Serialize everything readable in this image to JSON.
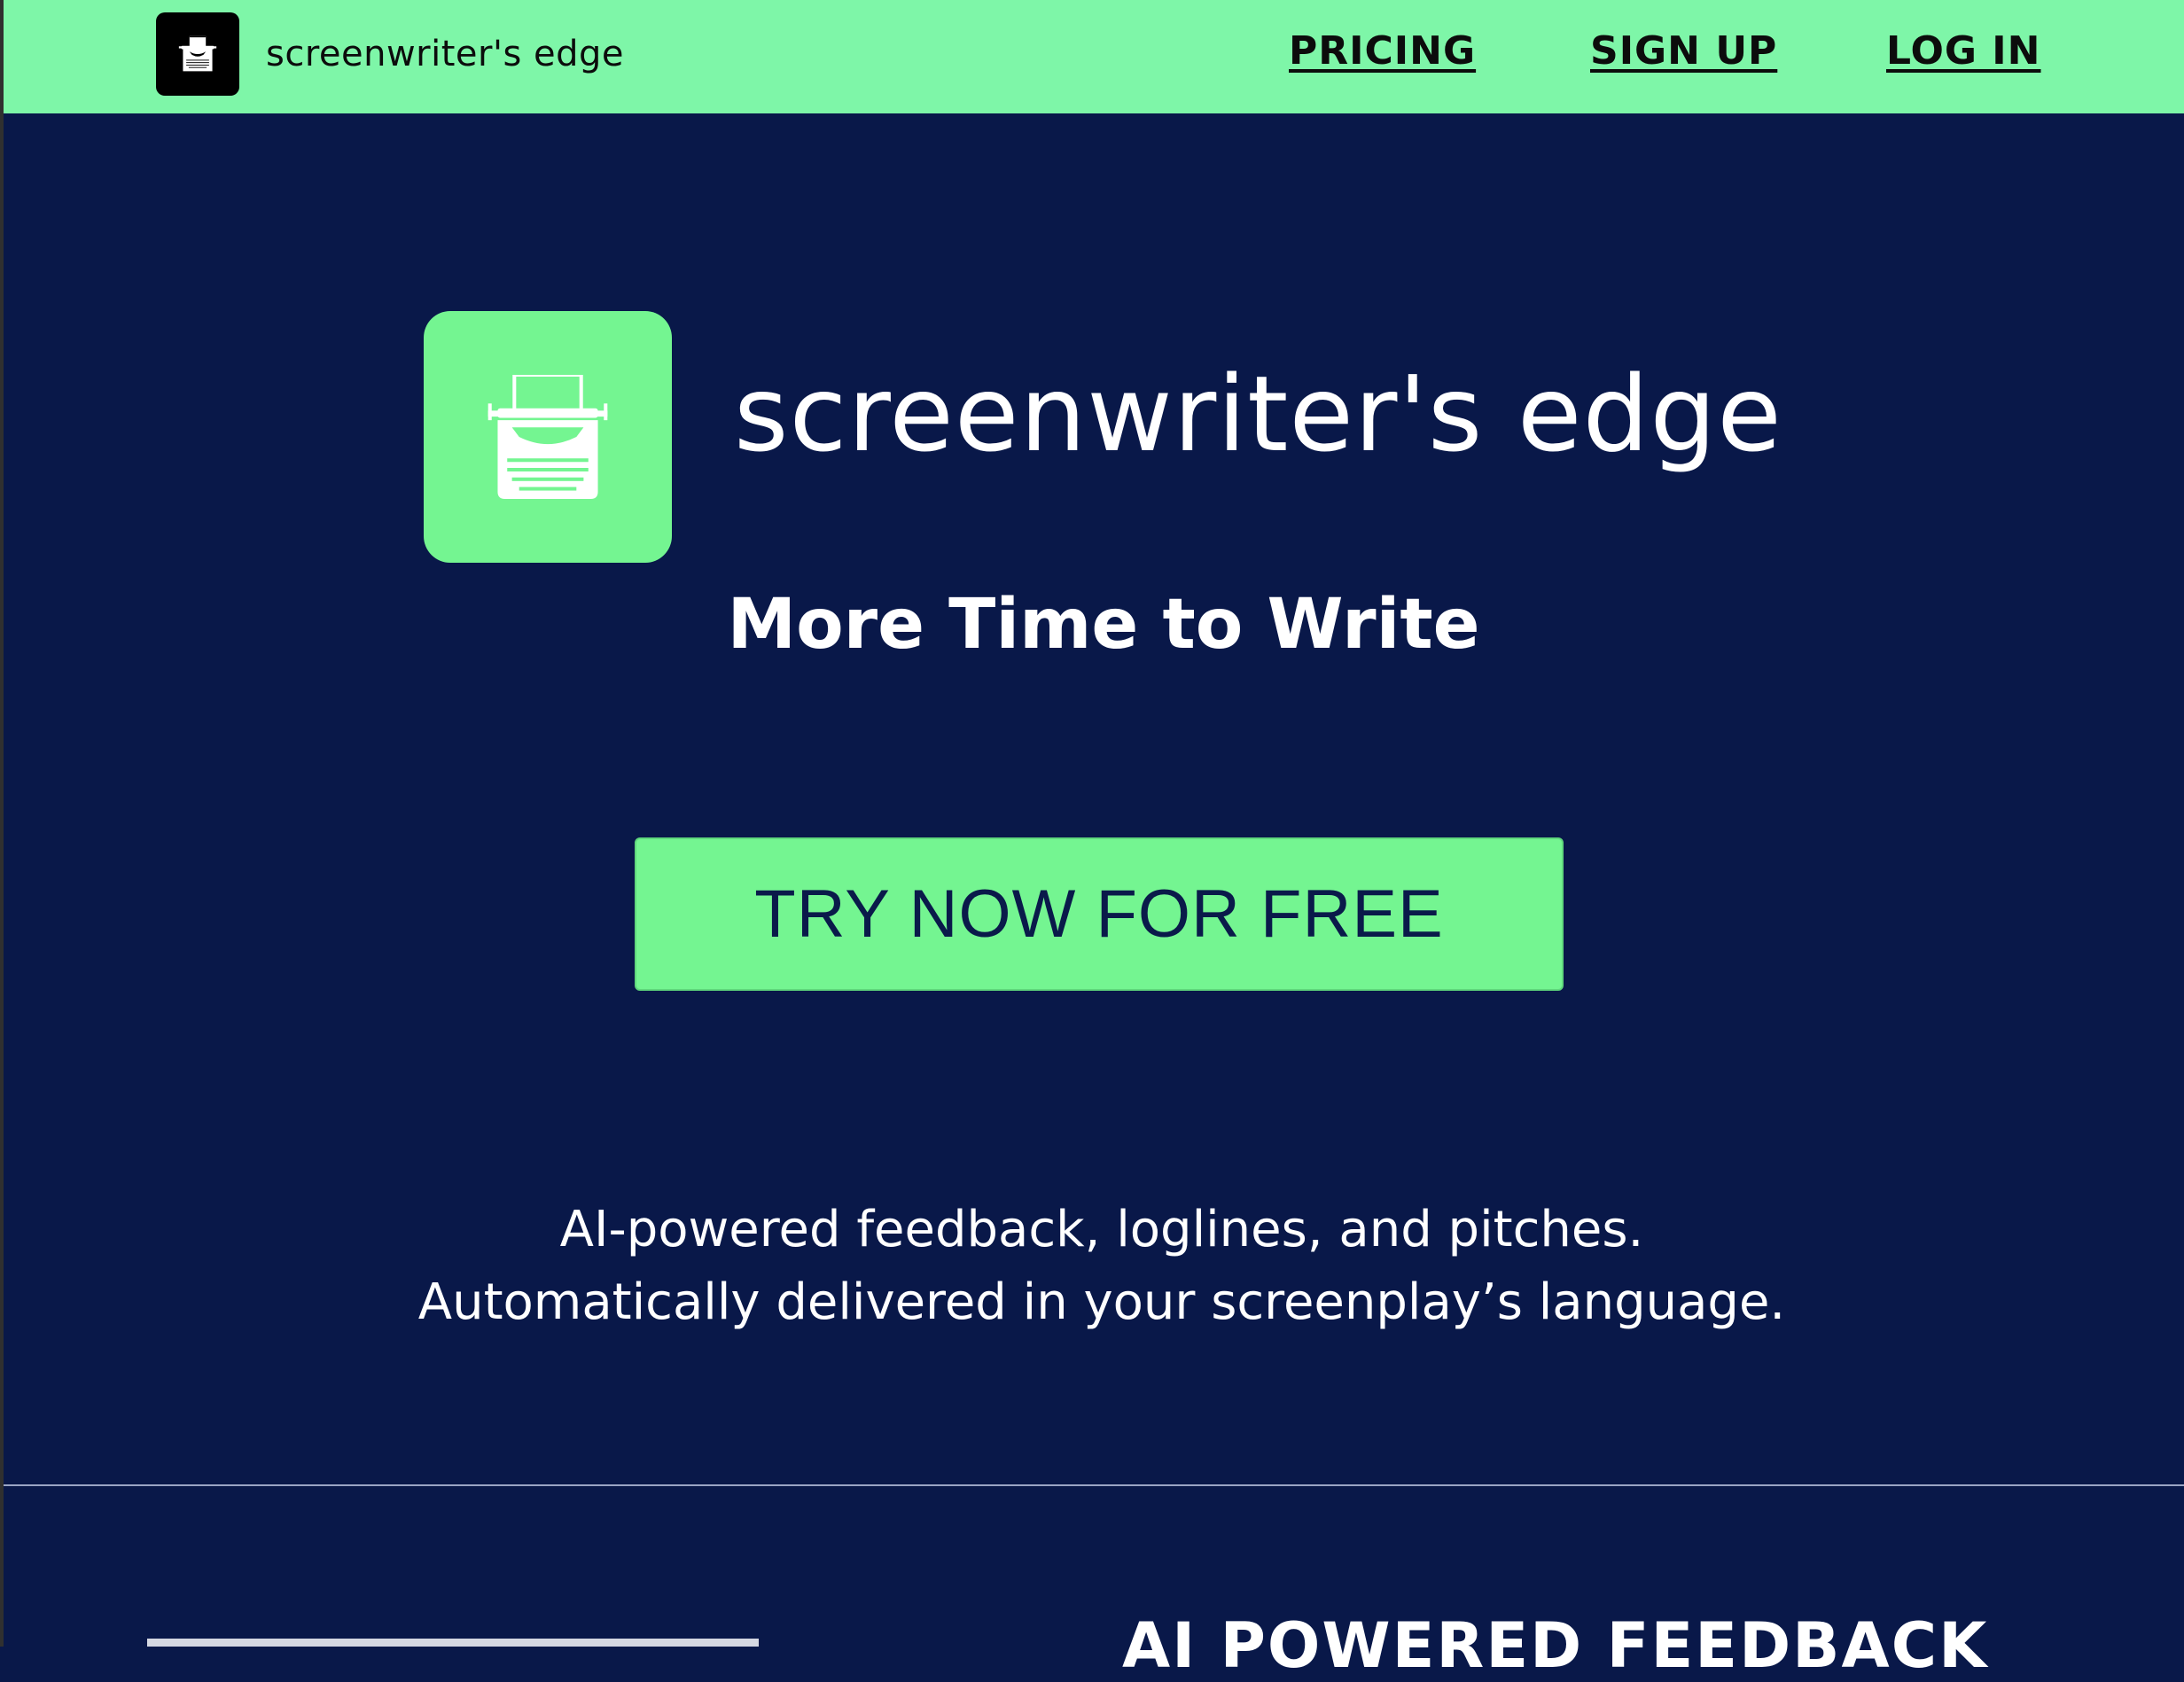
{
  "header": {
    "brand_name": "screenwriter's edge",
    "brand_icon": "typewriter-icon",
    "nav": {
      "pricing": "PRICING",
      "signup": "SIGN UP",
      "login": "LOG IN"
    }
  },
  "hero": {
    "logo_icon": "typewriter-icon",
    "title": "screenwriter's edge",
    "tagline": "More Time to Write",
    "cta_label": "TRY NOW FOR FREE",
    "description_line1": "AI-powered feedback, loglines, and pitches.",
    "description_line2": "Automatically delivered in your screenplay’s language."
  },
  "features": {
    "heading": "AI POWERED FEEDBACK"
  },
  "colors": {
    "accent_green": "#74f591",
    "header_green": "#7ef6a8",
    "background_navy": "#091849",
    "cta_text": "#0a1a4a"
  }
}
